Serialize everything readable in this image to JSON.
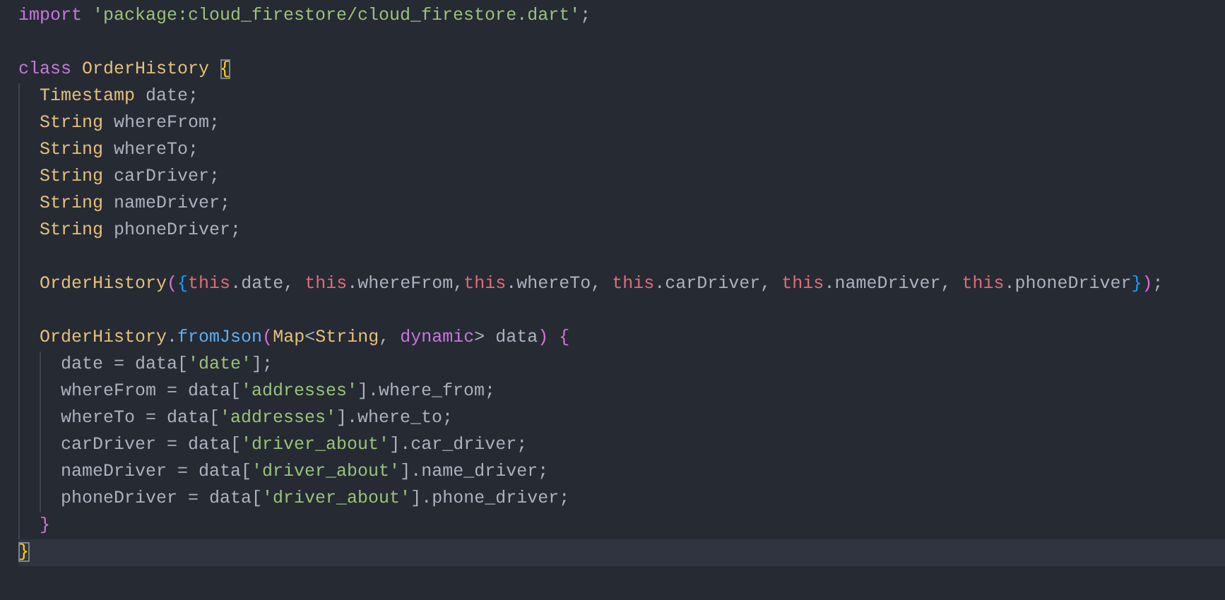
{
  "editor": {
    "lines": [
      {
        "current": false,
        "tokens": [
          {
            "kind": "kw",
            "t": "import "
          },
          {
            "kind": "str",
            "t": "'package:cloud_firestore/cloud_firestore.dart'"
          },
          {
            "kind": "plain",
            "t": ";"
          }
        ]
      },
      {
        "current": false
      },
      {
        "current": false,
        "tokens": [
          {
            "kind": "kw",
            "t": "class "
          },
          {
            "kind": "type",
            "t": "OrderHistory "
          },
          {
            "kind": "b1",
            "t": "{",
            "matched": true
          }
        ],
        "children": [
          {
            "current": false,
            "tokens": [
              {
                "kind": "type",
                "t": "Timestamp"
              },
              {
                "kind": "plain",
                "t": " date;"
              }
            ]
          },
          {
            "current": false,
            "tokens": [
              {
                "kind": "type",
                "t": "String"
              },
              {
                "kind": "plain",
                "t": " whereFrom;"
              }
            ]
          },
          {
            "current": false,
            "tokens": [
              {
                "kind": "type",
                "t": "String"
              },
              {
                "kind": "plain",
                "t": " whereTo;"
              }
            ]
          },
          {
            "current": false,
            "tokens": [
              {
                "kind": "type",
                "t": "String"
              },
              {
                "kind": "plain",
                "t": " carDriver;"
              }
            ]
          },
          {
            "current": false,
            "tokens": [
              {
                "kind": "type",
                "t": "String"
              },
              {
                "kind": "plain",
                "t": " nameDriver;"
              }
            ]
          },
          {
            "current": false,
            "tokens": [
              {
                "kind": "type",
                "t": "String"
              },
              {
                "kind": "plain",
                "t": " phoneDriver;"
              }
            ]
          },
          {
            "current": false
          },
          {
            "current": false,
            "tokens": [
              {
                "kind": "type",
                "t": "OrderHistory"
              },
              {
                "kind": "b2",
                "t": "("
              },
              {
                "kind": "b3",
                "t": "{"
              },
              {
                "kind": "this",
                "t": "this"
              },
              {
                "kind": "plain",
                "t": ".date, "
              },
              {
                "kind": "this",
                "t": "this"
              },
              {
                "kind": "plain",
                "t": ".whereFrom,"
              },
              {
                "kind": "this",
                "t": "this"
              },
              {
                "kind": "plain",
                "t": ".whereTo, "
              },
              {
                "kind": "this",
                "t": "this"
              },
              {
                "kind": "plain",
                "t": ".carDriver, "
              },
              {
                "kind": "this",
                "t": "this"
              },
              {
                "kind": "plain",
                "t": ".nameDriver, "
              },
              {
                "kind": "this",
                "t": "this"
              },
              {
                "kind": "plain",
                "t": ".phoneDriver"
              },
              {
                "kind": "b3",
                "t": "}"
              },
              {
                "kind": "b2",
                "t": ")"
              },
              {
                "kind": "plain",
                "t": ";"
              }
            ]
          },
          {
            "current": false
          },
          {
            "current": false,
            "tokens": [
              {
                "kind": "type",
                "t": "OrderHistory"
              },
              {
                "kind": "plain",
                "t": "."
              },
              {
                "kind": "fn",
                "t": "fromJson"
              },
              {
                "kind": "b2",
                "t": "("
              },
              {
                "kind": "type",
                "t": "Map"
              },
              {
                "kind": "plain",
                "t": "<"
              },
              {
                "kind": "type",
                "t": "String"
              },
              {
                "kind": "plain",
                "t": ", "
              },
              {
                "kind": "kw",
                "t": "dynamic"
              },
              {
                "kind": "plain",
                "t": "> data"
              },
              {
                "kind": "b2",
                "t": ") {"
              }
            ],
            "children": [
              {
                "current": false,
                "tokens": [
                  {
                    "kind": "plain",
                    "t": "date = data["
                  },
                  {
                    "kind": "str",
                    "t": "'date'"
                  },
                  {
                    "kind": "plain",
                    "t": "];"
                  }
                ]
              },
              {
                "current": false,
                "tokens": [
                  {
                    "kind": "plain",
                    "t": "whereFrom = data["
                  },
                  {
                    "kind": "str",
                    "t": "'addresses'"
                  },
                  {
                    "kind": "plain",
                    "t": "].where_from;"
                  }
                ]
              },
              {
                "current": false,
                "tokens": [
                  {
                    "kind": "plain",
                    "t": "whereTo = data["
                  },
                  {
                    "kind": "str",
                    "t": "'addresses'"
                  },
                  {
                    "kind": "plain",
                    "t": "].where_to;"
                  }
                ]
              },
              {
                "current": false,
                "tokens": [
                  {
                    "kind": "plain",
                    "t": "carDriver = data["
                  },
                  {
                    "kind": "str",
                    "t": "'driver_about'"
                  },
                  {
                    "kind": "plain",
                    "t": "].car_driver;"
                  }
                ]
              },
              {
                "current": false,
                "tokens": [
                  {
                    "kind": "plain",
                    "t": "nameDriver = data["
                  },
                  {
                    "kind": "str",
                    "t": "'driver_about'"
                  },
                  {
                    "kind": "plain",
                    "t": "].name_driver;"
                  }
                ]
              },
              {
                "current": false,
                "tokens": [
                  {
                    "kind": "plain",
                    "t": "phoneDriver = data["
                  },
                  {
                    "kind": "str",
                    "t": "'driver_about'"
                  },
                  {
                    "kind": "plain",
                    "t": "].phone_driver;"
                  }
                ]
              }
            ]
          },
          {
            "current": false,
            "tokens": [
              {
                "kind": "b2",
                "t": "}"
              }
            ]
          }
        ]
      },
      {
        "current": true,
        "tokens": [
          {
            "kind": "b1",
            "t": "}",
            "matched": true
          }
        ]
      }
    ]
  }
}
